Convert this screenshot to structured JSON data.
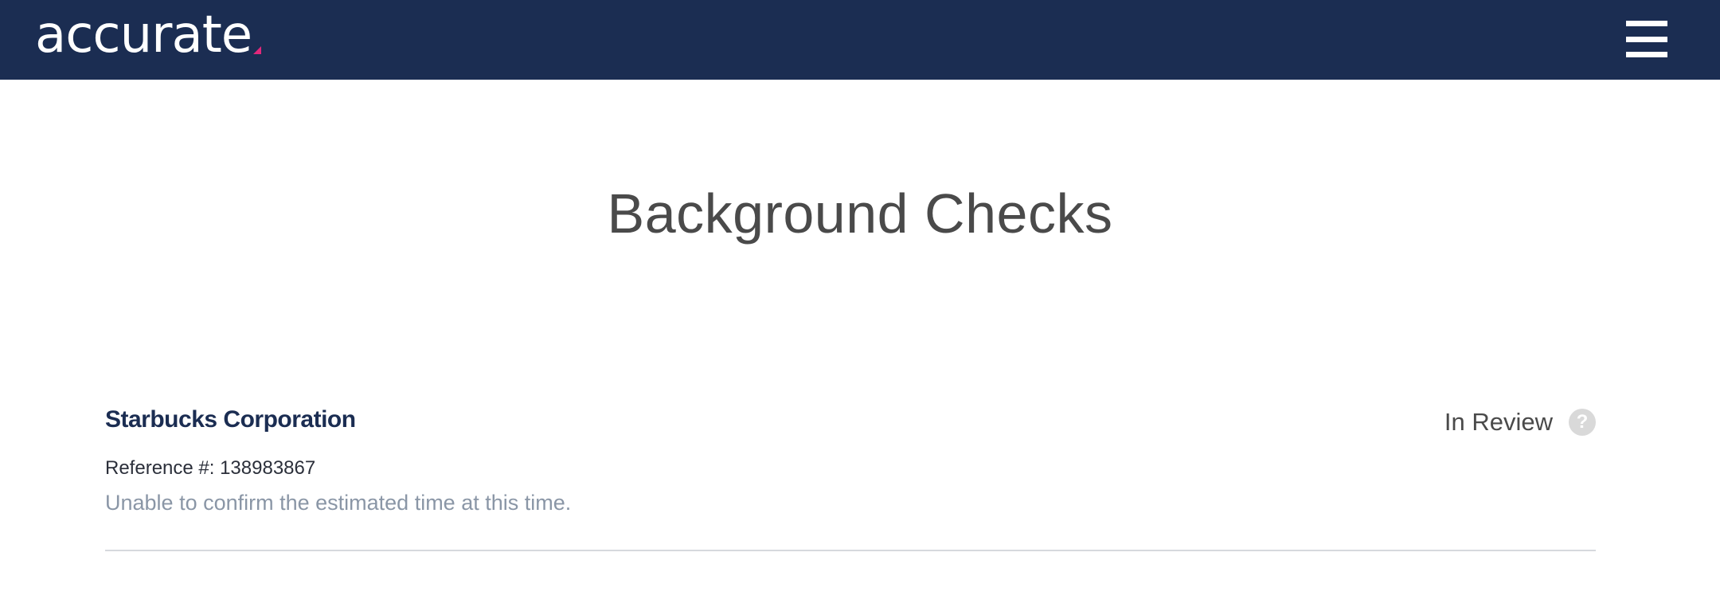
{
  "colors": {
    "nav_bg": "#1b2d52",
    "accent": "#e2287b",
    "muted": "#8a96a6"
  },
  "header": {
    "logo_text": "accurate",
    "menu_icon": "hamburger-menu-icon"
  },
  "main": {
    "title": "Background Checks"
  },
  "check": {
    "company": "Starbucks Corporation",
    "reference": "Reference #: 138983867",
    "estimate": "Unable to confirm the estimated time at this time.",
    "status": "In Review",
    "help_icon": "help-icon",
    "help_glyph": "?"
  }
}
